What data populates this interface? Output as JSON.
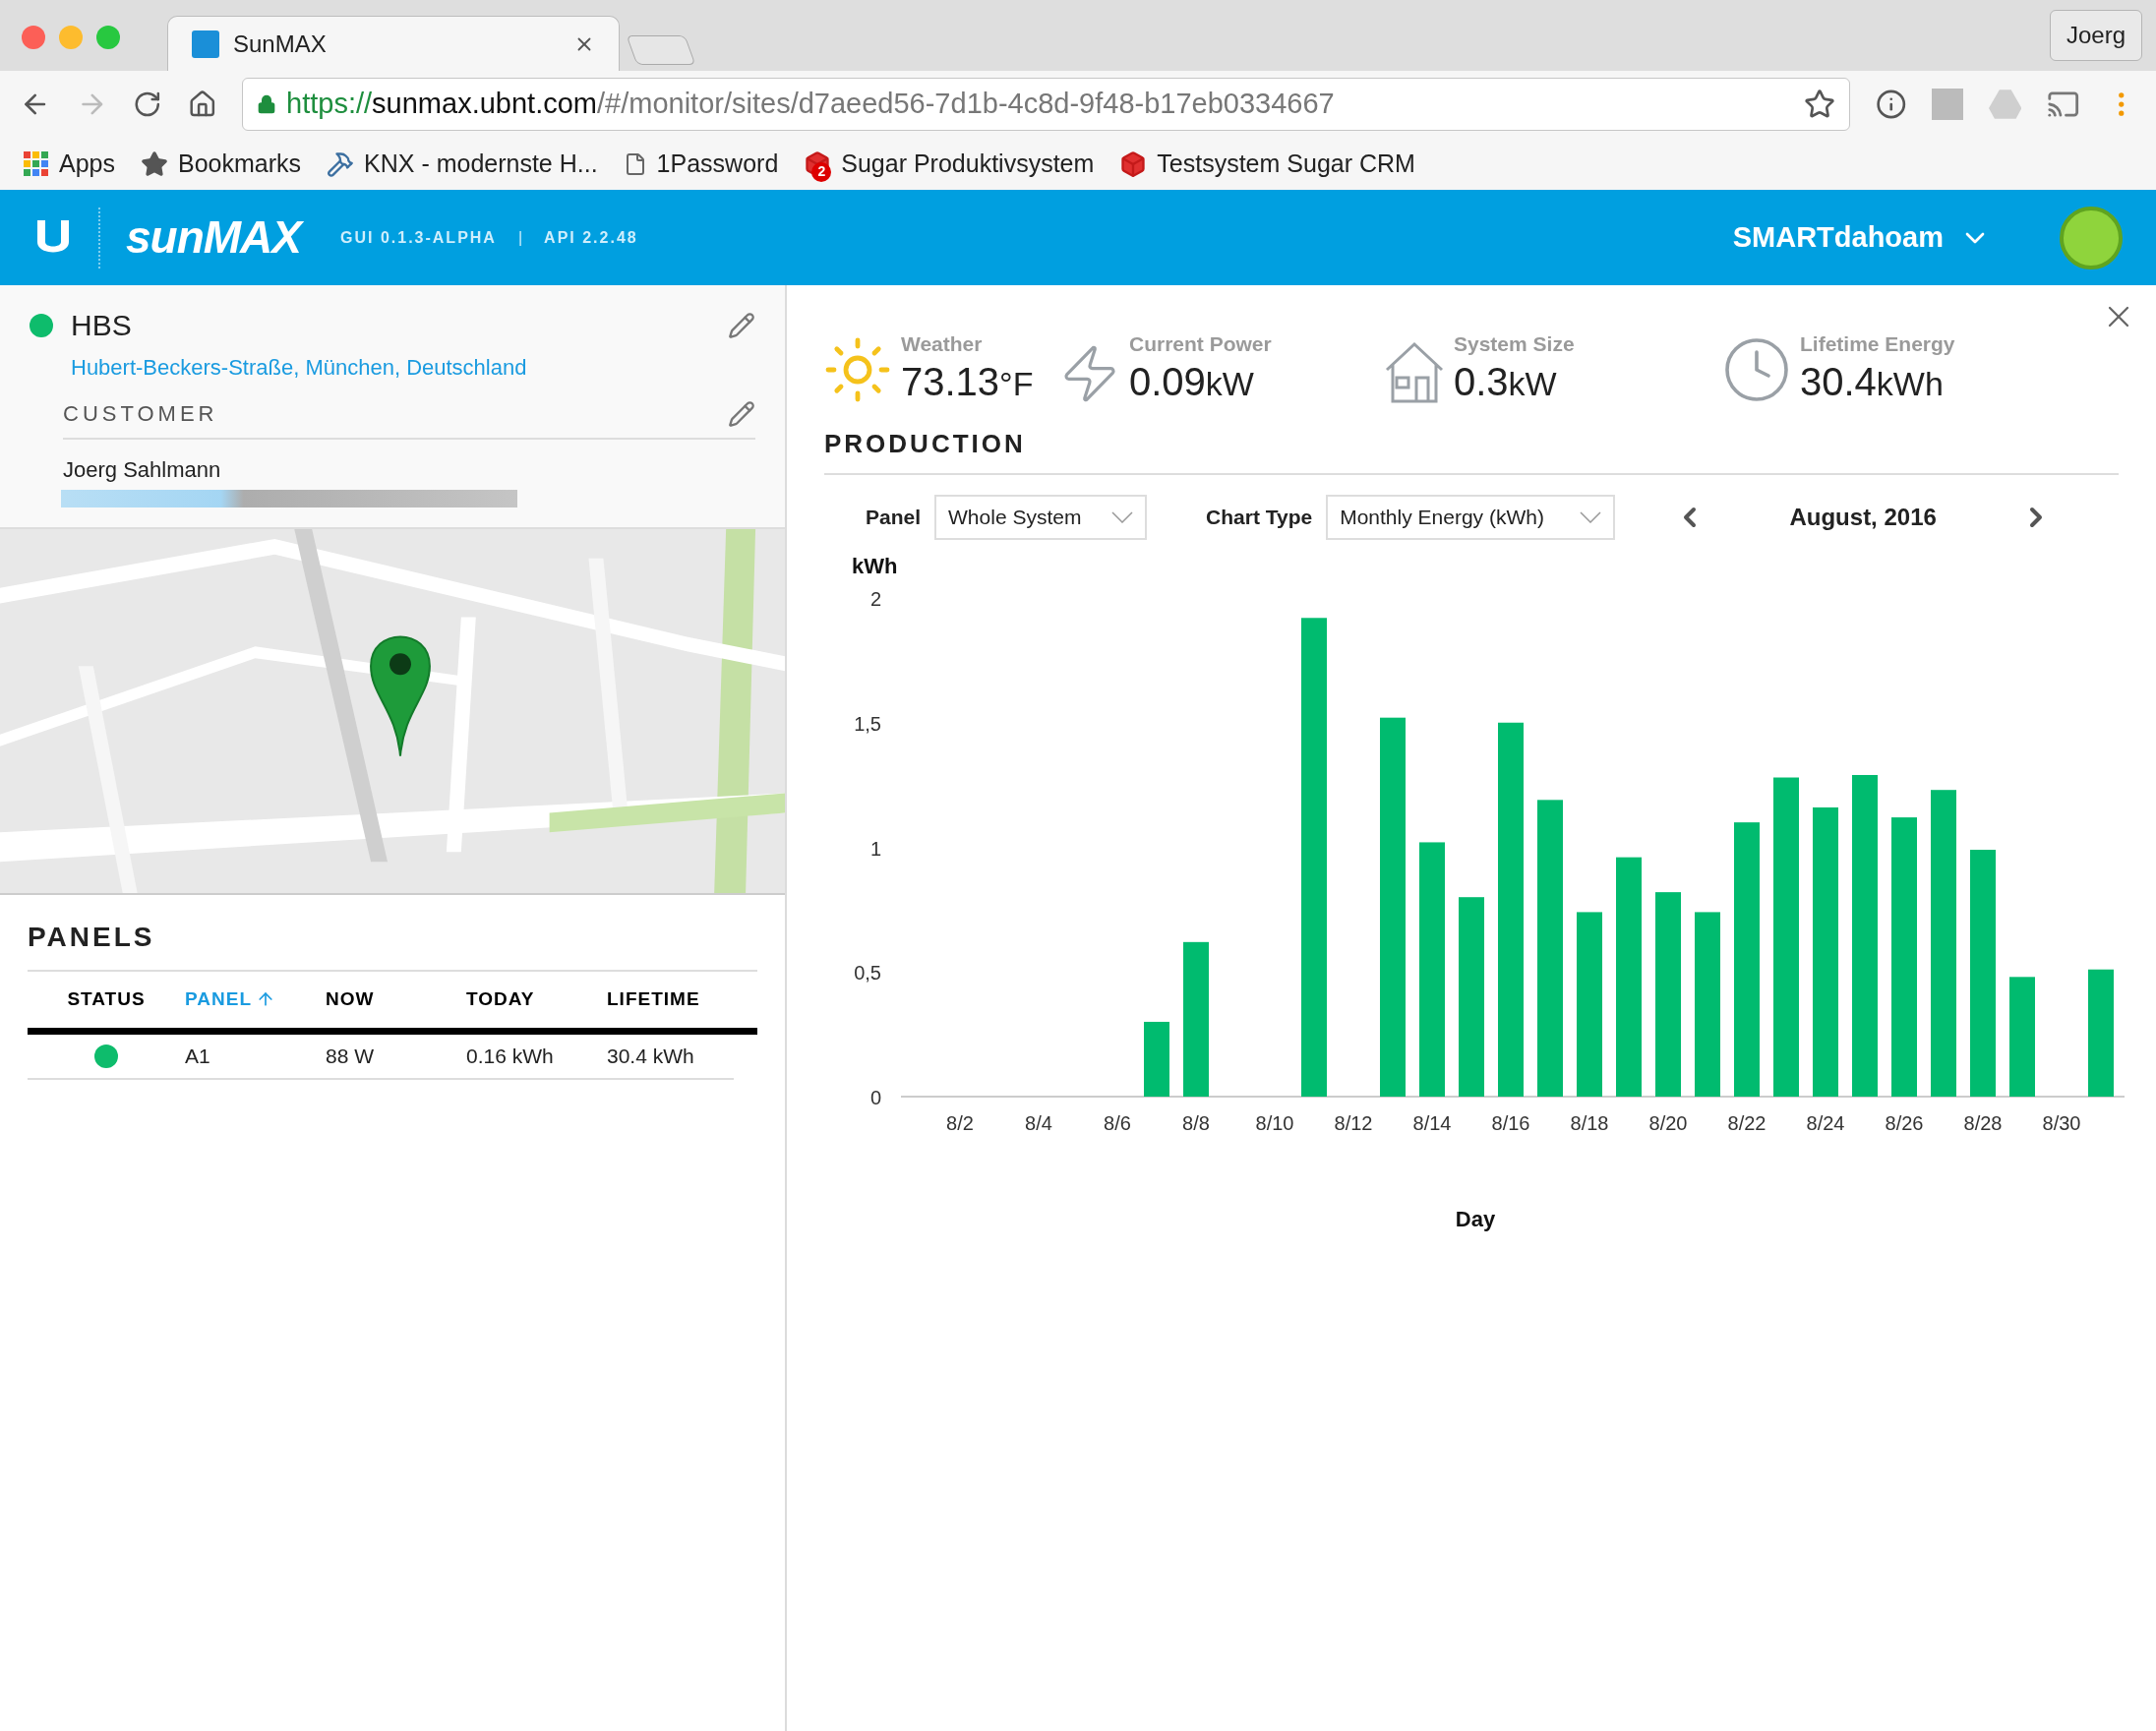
{
  "browser": {
    "tabs": [
      {
        "title": "SunMAX",
        "selected": true
      }
    ],
    "profile": "Joerg",
    "url": {
      "scheme": "https://",
      "host": "sunmax.ubnt.com",
      "path": "/#/monitor/sites/d7aeed56-7d1b-4c8d-9f48-b17eb0334667"
    },
    "bookmarks": [
      {
        "kind": "apps",
        "label": "Apps"
      },
      {
        "kind": "star",
        "label": "Bookmarks"
      },
      {
        "kind": "tool",
        "label": "KNX - modernste H..."
      },
      {
        "kind": "page",
        "label": "1Password"
      },
      {
        "kind": "cube",
        "label": "Sugar Produktivsystem",
        "badge": "2"
      },
      {
        "kind": "cube",
        "label": "Testsystem Sugar CRM"
      }
    ]
  },
  "header": {
    "logo": "sunMAX",
    "version": "GUI 0.1.3-ALPHA",
    "separator": "|",
    "api": "API 2.2.48",
    "site_menu": "SMARTdahoam"
  },
  "site": {
    "name": "HBS",
    "color": "#0ebc6c",
    "address": "Hubert-Beckers-Straße, München, Deutschland",
    "customer_label": "CUSTOMER",
    "customer_name": "Joerg Sahlmann"
  },
  "panels": {
    "title": "PANELS",
    "columns": [
      {
        "label": "STATUS",
        "sorted": false
      },
      {
        "label": "PANEL",
        "sorted": true
      },
      {
        "label": "NOW",
        "sorted": false
      },
      {
        "label": "TODAY",
        "sorted": false
      },
      {
        "label": "LIFETIME",
        "sorted": false
      }
    ],
    "rows": [
      {
        "color": "#0ebc6c",
        "panel": "A1",
        "now": "88 W",
        "today": "0.16 kWh",
        "lifetime": "30.4 kWh"
      }
    ]
  },
  "stats": [
    {
      "kind": "sun",
      "label": "Weather",
      "value": "73.13",
      "unit": "°F"
    },
    {
      "kind": "bolt",
      "label": "Current Power",
      "value": "0.09",
      "unit": "kW"
    },
    {
      "kind": "house",
      "label": "System Size",
      "value": "0.3",
      "unit": "kW"
    },
    {
      "kind": "clock",
      "label": "Lifetime Energy",
      "value": "30.4",
      "unit": "kWh"
    }
  ],
  "production": {
    "title": "PRODUCTION",
    "filters": [
      {
        "label": "Panel",
        "value": "Whole System"
      },
      {
        "label": "Chart Type",
        "value": "Monthly Energy (kWh)"
      }
    ],
    "period": "August, 2016",
    "chart_data": {
      "type": "bar",
      "xlabel": "Day",
      "ylabel": "kWh",
      "categories": [
        null,
        "8/2",
        null,
        "8/4",
        null,
        "8/6",
        null,
        "8/8",
        null,
        "8/10",
        null,
        "8/12",
        null,
        "8/14",
        null,
        "8/16",
        null,
        "8/18",
        null,
        "8/20",
        null,
        "8/22",
        null,
        "8/24",
        null,
        "8/26",
        null,
        "8/28",
        null,
        "8/30",
        null
      ],
      "series": [
        {
          "color": "#00bb6f",
          "values": [
            0,
            0,
            0,
            0,
            0,
            0,
            0.3,
            0.62,
            0,
            0,
            1.92,
            0,
            1.52,
            1.02,
            0.8,
            1.5,
            1.19,
            0.74,
            0.96,
            0.82,
            0.74,
            1.1,
            1.28,
            1.16,
            1.29,
            1.12,
            1.23,
            0.99,
            0.48,
            0,
            0.51
          ]
        }
      ],
      "ylim": [
        0,
        2
      ],
      "yticks": [
        {
          "value": 0,
          "label": "0"
        },
        {
          "value": 0.5,
          "label": "0,5"
        },
        {
          "value": 1,
          "label": "1"
        },
        {
          "value": 1.5,
          "label": "1,5"
        },
        {
          "value": 2,
          "label": "2"
        }
      ]
    }
  }
}
